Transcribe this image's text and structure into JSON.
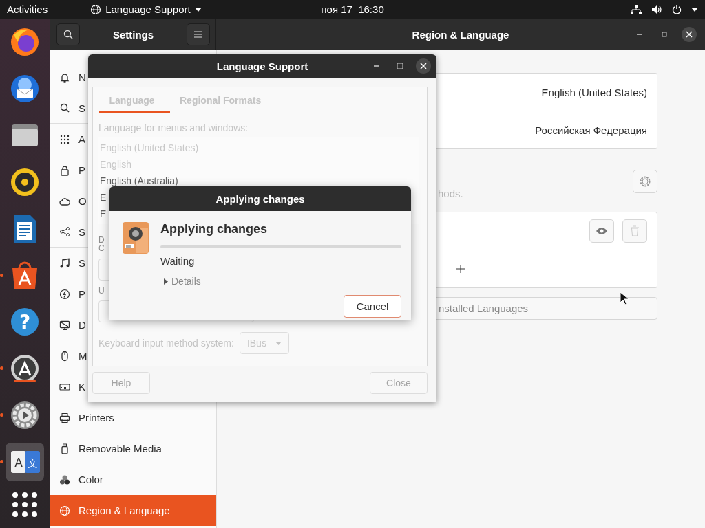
{
  "top_bar": {
    "activities": "Activities",
    "app_menu": "Language Support",
    "clock": "ноя 17  16:30"
  },
  "dock": [
    {
      "kind": "browser",
      "running": false,
      "active": false
    },
    {
      "kind": "mail",
      "running": false,
      "active": false
    },
    {
      "kind": "files",
      "running": false,
      "active": false
    },
    {
      "kind": "music",
      "running": false,
      "active": false
    },
    {
      "kind": "writer",
      "running": false,
      "active": false
    },
    {
      "kind": "software",
      "running": true,
      "active": false
    },
    {
      "kind": "help",
      "running": false,
      "active": false,
      "glyphs": [
        "?"
      ]
    },
    {
      "kind": "updater",
      "running": true,
      "active": false
    },
    {
      "kind": "settings",
      "running": true,
      "active": false
    },
    {
      "kind": "language",
      "running": true,
      "active": true,
      "glyphs": [
        "A",
        "文"
      ]
    },
    {
      "kind": "grid",
      "running": false,
      "active": false
    }
  ],
  "settings": {
    "title": "Settings",
    "page_title": "Region & Language",
    "sidebar": [
      {
        "kind": "bell",
        "label": "N",
        "selected": false,
        "divider_after": false
      },
      {
        "kind": "search",
        "label": "S",
        "selected": false,
        "divider_after": true
      },
      {
        "kind": "grid",
        "label": "A",
        "selected": false,
        "divider_after": false
      },
      {
        "kind": "lock",
        "label": "P",
        "selected": false,
        "divider_after": false
      },
      {
        "kind": "cloud",
        "label": "O",
        "selected": false,
        "divider_after": false
      },
      {
        "kind": "share",
        "label": "S",
        "selected": false,
        "divider_after": true
      },
      {
        "kind": "note",
        "label": "S",
        "selected": false,
        "divider_after": false
      },
      {
        "kind": "power",
        "label": "P",
        "selected": false,
        "divider_after": false
      },
      {
        "kind": "monitor",
        "label": "D",
        "selected": false,
        "divider_after": false
      },
      {
        "kind": "mouse",
        "label": "M",
        "selected": false,
        "divider_after": false
      },
      {
        "kind": "keyboard",
        "label": "K",
        "selected": false,
        "divider_after": false
      },
      {
        "kind": "printer",
        "label": "Printers",
        "selected": false,
        "divider_after": false
      },
      {
        "kind": "usb",
        "label": "Removable Media",
        "selected": false,
        "divider_after": false
      },
      {
        "kind": "circles",
        "label": "Color",
        "selected": false,
        "divider_after": false
      },
      {
        "kind": "globe",
        "label": "Region & Language",
        "selected": true,
        "divider_after": false
      }
    ],
    "language_rows": [
      {
        "value": "English (United States)"
      },
      {
        "value": "Российская Федерация"
      }
    ],
    "input_hint": "hods.",
    "manage_button": "nstalled Languages"
  },
  "language_support": {
    "title": "Language Support",
    "tabs": [
      {
        "label": "Language",
        "selected": true
      },
      {
        "label": "Regional Formats",
        "selected": false
      }
    ],
    "list_label": "Language for menus and windows:",
    "languages": [
      {
        "label": "English (United States)",
        "disabled": true
      },
      {
        "label": "English",
        "disabled": true
      },
      {
        "label": "English (Australia)",
        "disabled": false
      },
      {
        "label": "E",
        "disabled": false
      },
      {
        "label": "E",
        "disabled": false
      }
    ],
    "fragment_1": "D",
    "fragment_2": "C",
    "fragment_3": "U",
    "keyboard": {
      "label": "Keyboard input method system:",
      "value": "IBus",
      "disabled": true
    },
    "help": {
      "label": "Help",
      "disabled": true
    },
    "close": {
      "label": "Close",
      "disabled": true
    }
  },
  "dialog": {
    "title": "Applying changes",
    "heading": "Applying changes",
    "level": 0,
    "status": "Waiting",
    "details": {
      "label": "Details",
      "expanded": false
    },
    "cancel": "Cancel"
  }
}
